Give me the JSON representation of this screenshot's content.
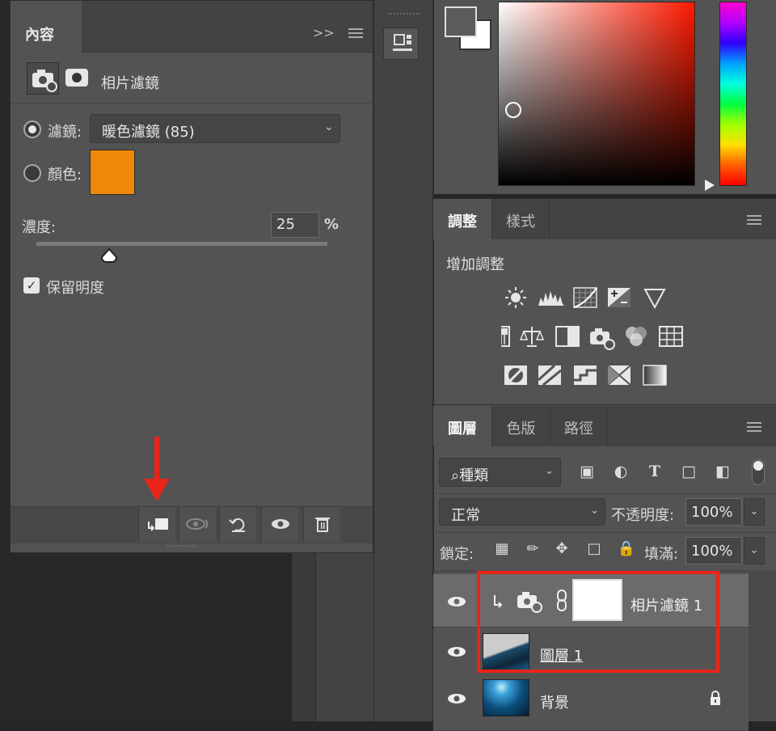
{
  "properties": {
    "tab_label": "內容",
    "expand_glyph": ">>",
    "title": "相片濾鏡",
    "filter_label": "濾鏡:",
    "filter_value": "暖色濾鏡 (85)",
    "color_label": "顏色:",
    "color_swatch": "#f0890a",
    "density_label": "濃度:",
    "density_value": "25",
    "density_unit": "%",
    "density_fraction": 0.25,
    "preserve_label": "保留明度",
    "preserve_checked": true
  },
  "adjustments": {
    "tabs": [
      "調整",
      "樣式"
    ],
    "title": "增加調整",
    "icons": [
      "brightness-contrast-icon",
      "levels-icon",
      "curves-icon",
      "exposure-icon",
      "vibrance-icon",
      "hue-saturation-icon",
      "color-balance-icon",
      "black-white-icon",
      "photo-filter-icon",
      "channel-mixer-icon",
      "color-lookup-icon",
      "invert-icon",
      "posterize-icon",
      "threshold-icon",
      "selective-color-icon",
      "gradient-map-icon"
    ]
  },
  "layers_panel": {
    "tabs": [
      "圖層",
      "色版",
      "路徑"
    ],
    "kind_label": "種類",
    "blend_mode": "正常",
    "opacity_label": "不透明度:",
    "opacity_value": "100%",
    "lock_label": "鎖定:",
    "fill_label": "填滿:",
    "fill_value": "100%",
    "layers": [
      {
        "name": "相片濾鏡 1",
        "selected": true
      },
      {
        "name": "圖層 1",
        "selected": false
      },
      {
        "name": "背景",
        "selected": false,
        "locked": true
      }
    ]
  },
  "colors": {
    "highlight_box": "#e8251a",
    "annotation_arrow": "#e8251a"
  }
}
